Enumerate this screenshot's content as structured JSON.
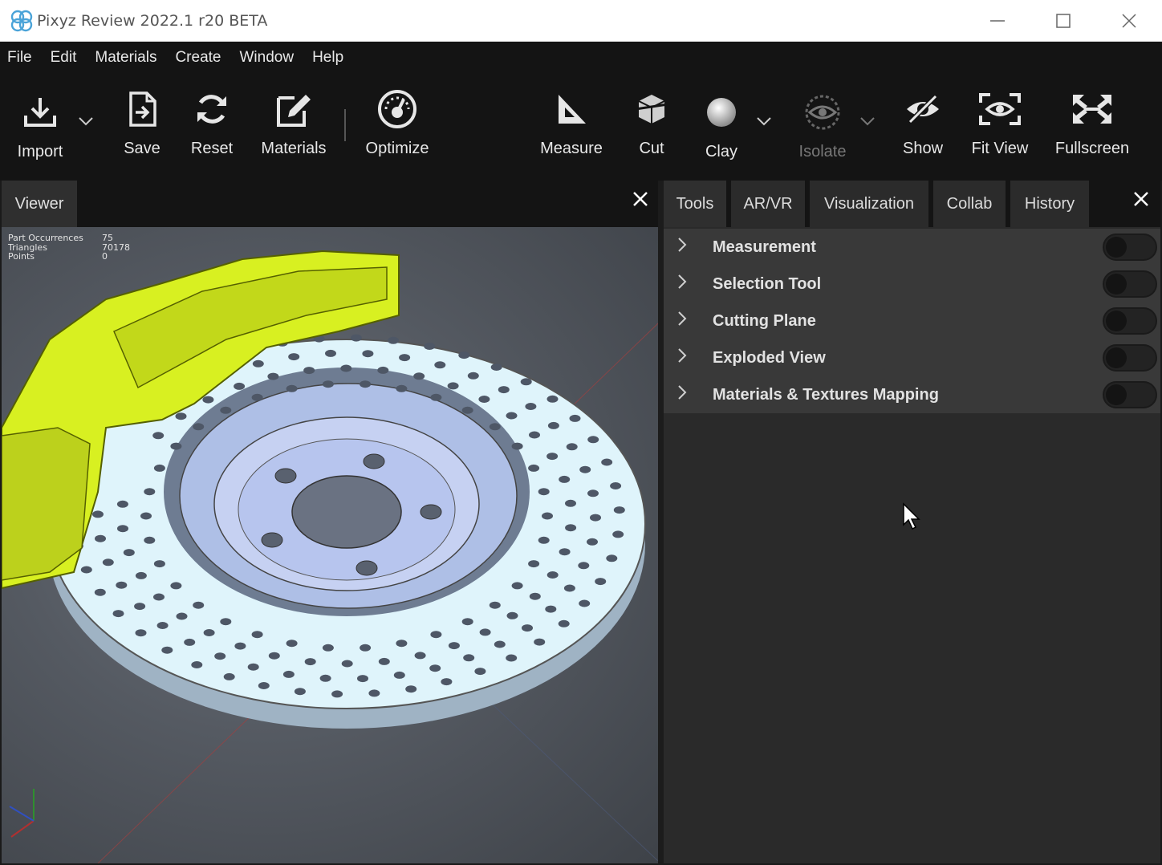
{
  "window": {
    "title": "Pixyz Review 2022.1 r20 BETA",
    "controls": [
      "minimize-icon",
      "maximize-icon",
      "close-icon"
    ]
  },
  "menu": [
    "File",
    "Edit",
    "Materials",
    "Create",
    "Window",
    "Help"
  ],
  "toolbar": {
    "import": "Import",
    "save": "Save",
    "reset": "Reset",
    "materials": "Materials",
    "optimize": "Optimize",
    "measure": "Measure",
    "cut": "Cut",
    "clay": "Clay",
    "isolate": "Isolate",
    "show": "Show",
    "fit_view": "Fit View",
    "fullscreen": "Fullscreen"
  },
  "viewer": {
    "tab": "Viewer",
    "stats": [
      {
        "label": "Part Occurrences",
        "value": "75"
      },
      {
        "label": "Triangles",
        "value": "70178"
      },
      {
        "label": "Points",
        "value": "0"
      }
    ]
  },
  "right_panel": {
    "tabs": [
      "Tools",
      "AR/VR",
      "Visualization",
      "Collab",
      "History"
    ],
    "tools": [
      {
        "name": "Measurement",
        "enabled": false
      },
      {
        "name": "Selection Tool",
        "enabled": false
      },
      {
        "name": "Cutting Plane",
        "enabled": false
      },
      {
        "name": "Exploded View",
        "enabled": false
      },
      {
        "name": "Materials & Textures Mapping",
        "enabled": false
      }
    ]
  },
  "colors": {
    "caliper": "#d8f021",
    "disc": "#dff4fb",
    "background": "#141414",
    "panel": "#2a2a2a",
    "row": "#393939"
  }
}
